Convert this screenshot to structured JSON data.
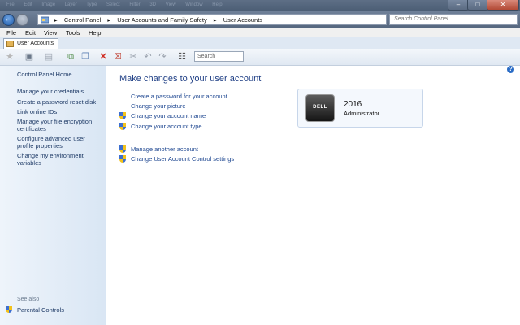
{
  "titlebar": {
    "ghost_menu": [
      "File",
      "Edit",
      "Image",
      "Layer",
      "Type",
      "Select",
      "Filter",
      "3D",
      "View",
      "Window",
      "Help"
    ]
  },
  "nav": {
    "breadcrumbs": [
      "Control Panel",
      "User Accounts and Family Safety",
      "User Accounts"
    ],
    "search_placeholder": "Search Control Panel"
  },
  "menubar": [
    "File",
    "Edit",
    "View",
    "Tools",
    "Help"
  ],
  "tab": {
    "label": "User Accounts"
  },
  "toolbar": {
    "search_placeholder": "Search"
  },
  "sidebar": {
    "home": "Control Panel Home",
    "links": [
      "Manage your credentials",
      "Create a password reset disk",
      "Link online IDs",
      "Manage your file encryption certificates",
      "Configure advanced user profile properties",
      "Change my environment variables"
    ],
    "see_also": "See also",
    "parental_controls": "Parental Controls"
  },
  "main": {
    "heading": "Make changes to your user account",
    "links": [
      "Create a password for your account",
      "Change your picture",
      "Change your account name",
      "Change your account type"
    ],
    "links2": [
      "Manage another account",
      "Change User Account Control settings"
    ]
  },
  "account": {
    "name": "2016",
    "type": "Administrator",
    "avatar_label": "DELL"
  },
  "colors": {
    "link": "#1d4690",
    "heading": "#1f3f85",
    "titlebar": "#4b5d74",
    "sidebar": "#dde9f5"
  }
}
